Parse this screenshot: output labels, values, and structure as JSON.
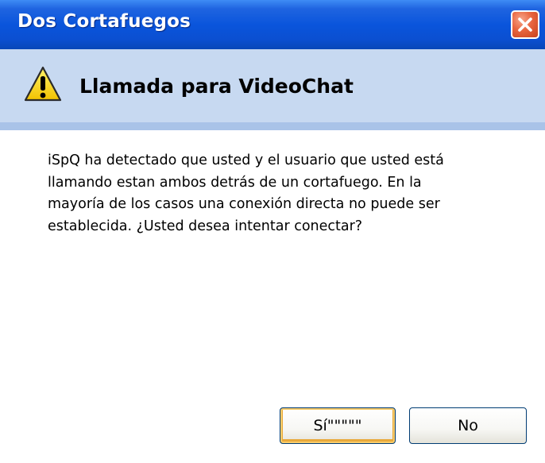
{
  "window": {
    "title": "Dos Cortafuegos"
  },
  "header": {
    "icon": "warning-icon",
    "title": "Llamada para VideoChat"
  },
  "message": {
    "lines": [
      "iSpQ ha detectado que usted y el usuario que usted está",
      "llamando estan ambos detrás de un cortafuego.  En la",
      "mayoría de los casos una conexión directa no puede ser",
      "establecida.  ¿Usted desea intentar conectar?"
    ]
  },
  "buttons": {
    "yes_label": "Sí\"\"\"\"\"",
    "no_label": "No"
  },
  "colors": {
    "titlebar": "#0a55dc",
    "header_band": "#c7d9f1",
    "close_button": "#e8653f"
  }
}
